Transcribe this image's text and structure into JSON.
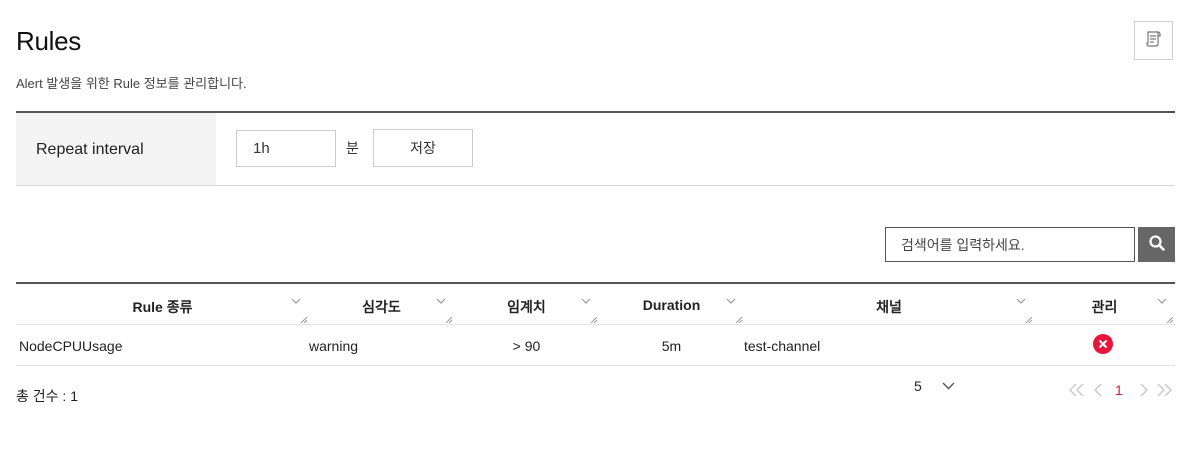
{
  "header": {
    "title": "Rules",
    "description": "Alert 발생을 위한 Rule 정보를 관리합니다.",
    "doc_icon": "document-icon"
  },
  "repeat_interval": {
    "label": "Repeat interval",
    "value": "1h",
    "unit": "분",
    "save_label": "저장"
  },
  "search": {
    "placeholder": "검색어를 입력하세요.",
    "icon": "search-icon"
  },
  "table": {
    "columns": [
      "Rule 종류",
      "심각도",
      "임계치",
      "Duration",
      "채널",
      "관리"
    ],
    "rows": [
      {
        "rule_type": "NodeCPUUsage",
        "severity": "warning",
        "threshold": "> 90",
        "duration": "5m",
        "channel": "test-channel",
        "action_icon": "delete-icon"
      }
    ]
  },
  "footer": {
    "total_label": "총 건수 : 1",
    "page_size": "5",
    "current_page": "1"
  },
  "colors": {
    "accent_red": "#e8143c",
    "page_active": "#d81b3a",
    "search_button": "#666666",
    "label_cell_bg": "#f4f4f4"
  }
}
